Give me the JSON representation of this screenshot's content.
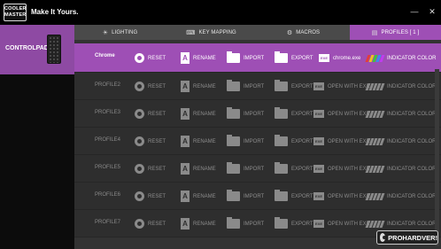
{
  "app": {
    "logo_text": "COOLER MASTER",
    "tagline": "Make It Yours.",
    "window_controls": {
      "minimize": "—",
      "close": "✕"
    }
  },
  "device": {
    "name": "CONTROLPAD_U"
  },
  "tabs": [
    {
      "label": "LIGHTING",
      "icon": "bulb-icon",
      "active": false
    },
    {
      "label": "KEY MAPPING",
      "icon": "keyboard-icon",
      "active": false
    },
    {
      "label": "MACROS",
      "icon": "macros-icon",
      "active": false
    },
    {
      "label": "PROFILES [ 1 ]",
      "icon": "profiles-icon",
      "active": true
    }
  ],
  "actions": {
    "reset": "RESET",
    "rename": "RENAME",
    "import": "IMPORT",
    "export": "EXPORT",
    "open_with_exe": "OPEN WITH EXE",
    "indicator_color": "INDICATOR COLOR"
  },
  "profiles": [
    {
      "name": "Chrome",
      "exe": "chrome.exe",
      "active": true
    },
    {
      "name": "PROFILE2",
      "exe": "OPEN WITH EXE",
      "active": false
    },
    {
      "name": "PROFILE3",
      "exe": "OPEN WITH EXE",
      "active": false
    },
    {
      "name": "PROFILE4",
      "exe": "OPEN WITH EXE",
      "active": false
    },
    {
      "name": "PROFILE5",
      "exe": "OPEN WITH EXE",
      "active": false
    },
    {
      "name": "PROFILE6",
      "exe": "OPEN WITH EXE",
      "active": false
    },
    {
      "name": "PROFILE7",
      "exe": "OPEN WITH EXE",
      "active": false
    }
  ],
  "indicator_colors_active": [
    "#e23c3c",
    "#f0c020",
    "#3cc83c",
    "#3c8cf0",
    "#c03cf0"
  ],
  "watermark": "PROHARDVER!",
  "colors": {
    "accent": "#9e4fb5",
    "device_card": "#8e4aa3",
    "background": "#333333"
  }
}
